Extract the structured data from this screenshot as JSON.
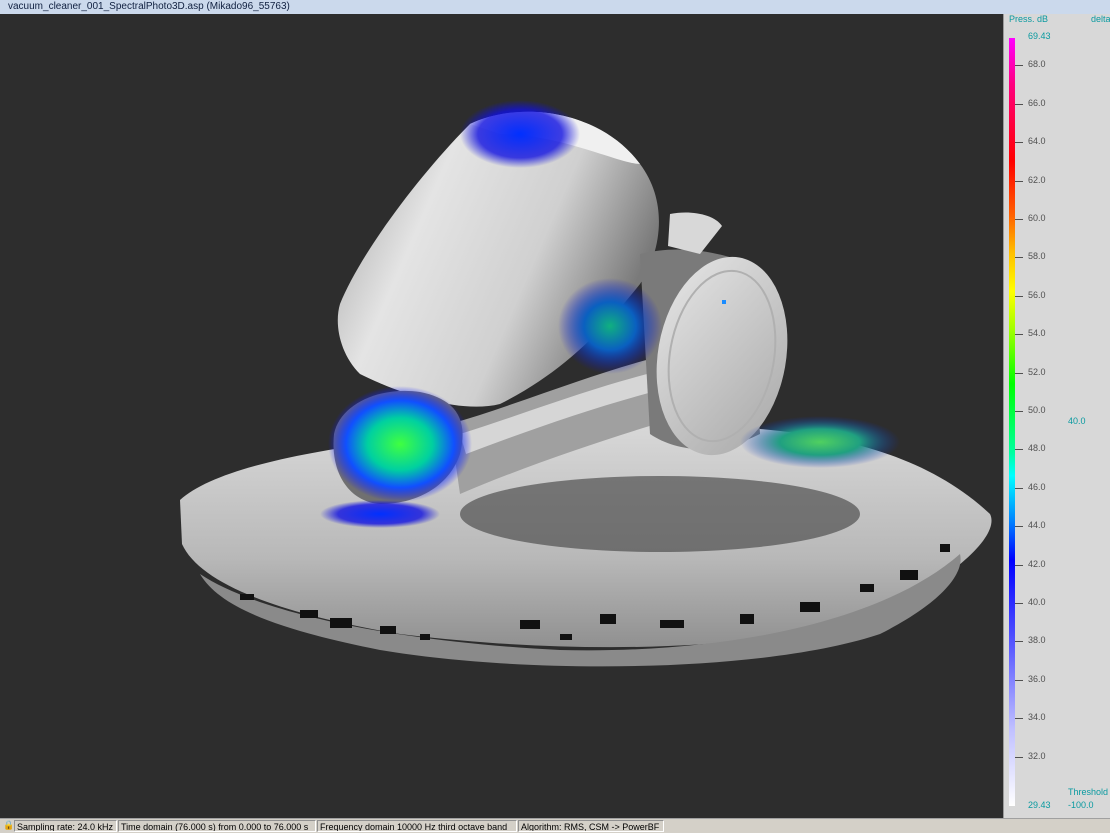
{
  "window": {
    "title": "vacuum_cleaner_001_SpectralPhoto3D.asp (Mikado96_55763)"
  },
  "scale": {
    "header_left": "Press. dB",
    "header_right": "delta",
    "max_label": "69.43",
    "min_label": "29.43",
    "ticks": [
      "68.0",
      "66.0",
      "64.0",
      "62.0",
      "60.0",
      "58.0",
      "56.0",
      "54.0",
      "52.0",
      "50.0",
      "48.0",
      "46.0",
      "44.0",
      "42.0",
      "40.0",
      "38.0",
      "36.0",
      "34.0",
      "32.0"
    ],
    "delta_value": "40.0",
    "threshold_label": "Threshold",
    "threshold_value": "-100.0",
    "range_min": 29.43,
    "range_max": 69.43
  },
  "status": {
    "lock_icon": "lock-icon",
    "sampling": "Sampling rate: 24.0 kHz",
    "time_domain": "Time domain (76.000 s) from 0.000 to 76.000 s",
    "frequency": "Frequency domain 10000 Hz third octave band",
    "algorithm": "Algorithm: RMS, CSM -> PowerBF"
  },
  "colors": {
    "title_bg": "#cbd9ec",
    "viewport_bg": "#2d2d2d",
    "label_teal": "#0a9aa0"
  }
}
